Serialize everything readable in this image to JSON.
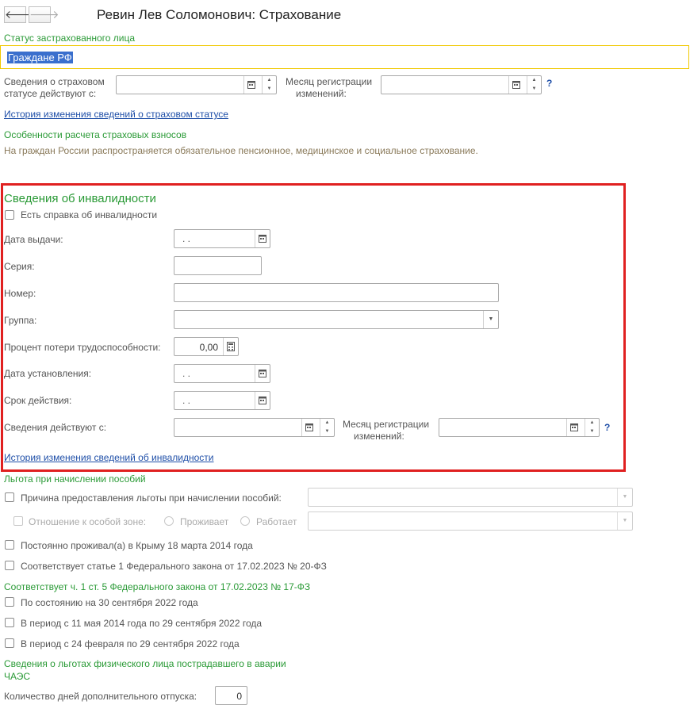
{
  "window": {
    "title": "Ревин Лев Соломонович: Страхование"
  },
  "status": {
    "label": "Статус застрахованного лица",
    "value": "Граждане РФ"
  },
  "insurance_status": {
    "effective_label_1": "Сведения о страховом",
    "effective_label_2": "статусе действуют с:",
    "month_label_1": "Месяц регистрации",
    "month_label_2": "изменений:",
    "help": "?",
    "history_link": "История изменения сведений о страховом статусе"
  },
  "features": {
    "heading": "Особенности расчета страховых взносов",
    "text": "На граждан России распространяется обязательное пенсионное, медицинское и социальное страхование."
  },
  "disability": {
    "heading": "Сведения об инвалидности",
    "has_certificate_label": "Есть справка об инвалидности",
    "issue_date_label": "Дата выдачи:",
    "issue_date_value": " .  .",
    "series_label": "Серия:",
    "number_label": "Номер:",
    "group_label": "Группа:",
    "percent_label": "Процент потери трудоспособности:",
    "percent_value": "0,00",
    "established_label": "Дата установления:",
    "established_value": " .  .",
    "validity_label": "Срок действия:",
    "validity_value": " .  .",
    "effective_label": "Сведения действуют с:",
    "month_label_1": "Месяц регистрации",
    "month_label_2": "изменений:",
    "help": "?",
    "history_link": "История изменения сведений об инвалидности"
  },
  "benefits": {
    "heading": "Льгота при начислении пособий",
    "reason_label": "Причина предоставления льготы при начислении пособий:",
    "zone_label": "Отношение к особой зоне:",
    "zone_live": "Проживает",
    "zone_work": "Работает",
    "crimea_label": "Постоянно проживал(а) в Крыму 18 марта 2014 года",
    "law20_label": "Соответствует статье 1 Федерального закона от 17.02.2023 № 20-ФЗ"
  },
  "law17": {
    "heading": "Соответствует ч. 1 ст. 5 Федерального закона от 17.02.2023 № 17-ФЗ",
    "opt1": "По состоянию на 30 сентября 2022 года",
    "opt2": "В период с 11 мая 2014 года по 29 сентября 2022 года",
    "opt3": "В период с 24 февраля по 29 сентября 2022 года"
  },
  "chaes": {
    "heading_1": "Сведения о льготах физического лица пострадавшего в аварии",
    "heading_2": "ЧАЭС",
    "days_label": "Количество дней дополнительного отпуска:",
    "days_value": "0"
  },
  "colors": {
    "accent_green": "#2a9a36",
    "link_blue": "#1f4fa8",
    "highlight_red": "#e02020",
    "status_border": "#f0c800"
  }
}
